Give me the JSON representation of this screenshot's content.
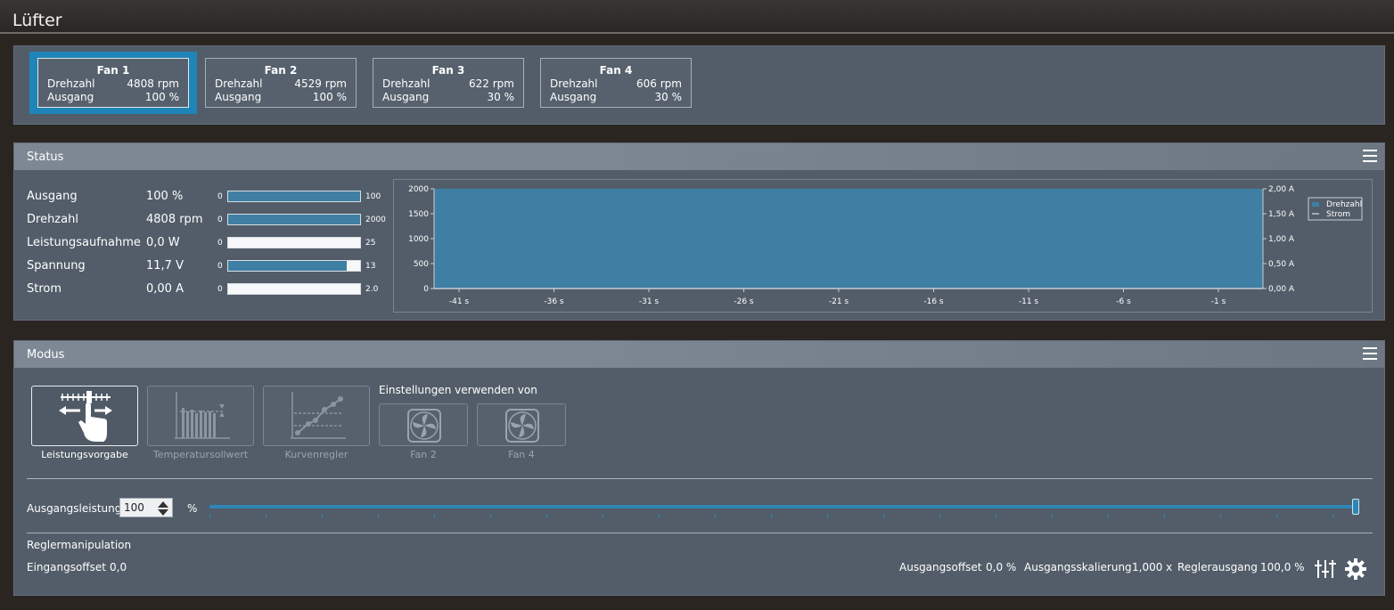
{
  "window": {
    "title": "Lüfter"
  },
  "fans": [
    {
      "name": "Fan 1",
      "speed_label": "Drehzahl",
      "speed": "4808 rpm",
      "output_label": "Ausgang",
      "output": "100 %",
      "selected": true
    },
    {
      "name": "Fan 2",
      "speed_label": "Drehzahl",
      "speed": "4529 rpm",
      "output_label": "Ausgang",
      "output": "100 %",
      "selected": false
    },
    {
      "name": "Fan 3",
      "speed_label": "Drehzahl",
      "speed": "622 rpm",
      "output_label": "Ausgang",
      "output": "30 %",
      "selected": false
    },
    {
      "name": "Fan 4",
      "speed_label": "Drehzahl",
      "speed": "606 rpm",
      "output_label": "Ausgang",
      "output": "30 %",
      "selected": false
    }
  ],
  "status": {
    "title": "Status",
    "rows": [
      {
        "label": "Ausgang",
        "value": "100 %",
        "min": "0",
        "max": "100",
        "fill": 1.0
      },
      {
        "label": "Drehzahl",
        "value": "4808 rpm",
        "min": "0",
        "max": "2000",
        "fill": 1.0
      },
      {
        "label": "Leistungsaufnahme",
        "value": "0,0 W",
        "min": "0",
        "max": "25",
        "fill": 0.0
      },
      {
        "label": "Spannung",
        "value": "11,7 V",
        "min": "0",
        "max": "13",
        "fill": 0.9
      },
      {
        "label": "Strom",
        "value": "0,00 A",
        "min": "0",
        "max": "2.0",
        "fill": 0.0
      }
    ]
  },
  "chart_data": {
    "type": "area",
    "x_ticks": [
      "-41 s",
      "-36 s",
      "-31 s",
      "-26 s",
      "-21 s",
      "-16 s",
      "-11 s",
      "-6 s",
      "-1 s"
    ],
    "y_left_ticks": [
      "2000",
      "1500",
      "1000",
      "500",
      "0"
    ],
    "y_right_ticks": [
      "2,00 A",
      "1,50 A",
      "1,00 A",
      "0,50 A",
      "0,00 A"
    ],
    "ylim_left": [
      0,
      2000
    ],
    "ylim_right": [
      0,
      2.0
    ],
    "series": [
      {
        "name": "Drehzahl",
        "color": "#3f7fa3",
        "values": [
          2000,
          2000,
          2000,
          2000,
          2000,
          2000,
          2000,
          2000,
          2000
        ]
      },
      {
        "name": "Strom",
        "color": "#c0c6cc",
        "values": [
          0,
          0,
          0,
          0,
          0,
          0,
          0,
          0,
          0
        ]
      }
    ],
    "legend": "top-right"
  },
  "mode": {
    "title": "Modus",
    "buttons": [
      {
        "label": "Leistungsvorgabe",
        "icon": "manual-control-icon",
        "active": true
      },
      {
        "label": "Temperatursollwert",
        "icon": "temperature-target-icon",
        "active": false
      },
      {
        "label": "Kurvenregler",
        "icon": "curve-control-icon",
        "active": false
      }
    ],
    "use_settings_label": "Einstellungen verwenden von",
    "sources": [
      {
        "label": "Fan 2",
        "icon": "fan-icon"
      },
      {
        "label": "Fan 4",
        "icon": "fan-icon"
      }
    ],
    "output_power_label": "Ausgangsleistung",
    "output_power_value": "100",
    "unit_percent": "%",
    "slider_level": 1.0,
    "controller_manipulation_label": "Reglermanipulation",
    "input_offset_label": "Eingangsoffset",
    "input_offset_value": "0,0",
    "output_offset_label": "Ausgangsoffset",
    "output_offset_value": "0,0 %",
    "output_scaling_label": "Ausgangsskalierung",
    "output_scaling_value": "1,000 x",
    "controller_output_label": "Reglerausgang",
    "controller_output_value": "100,0 %"
  }
}
